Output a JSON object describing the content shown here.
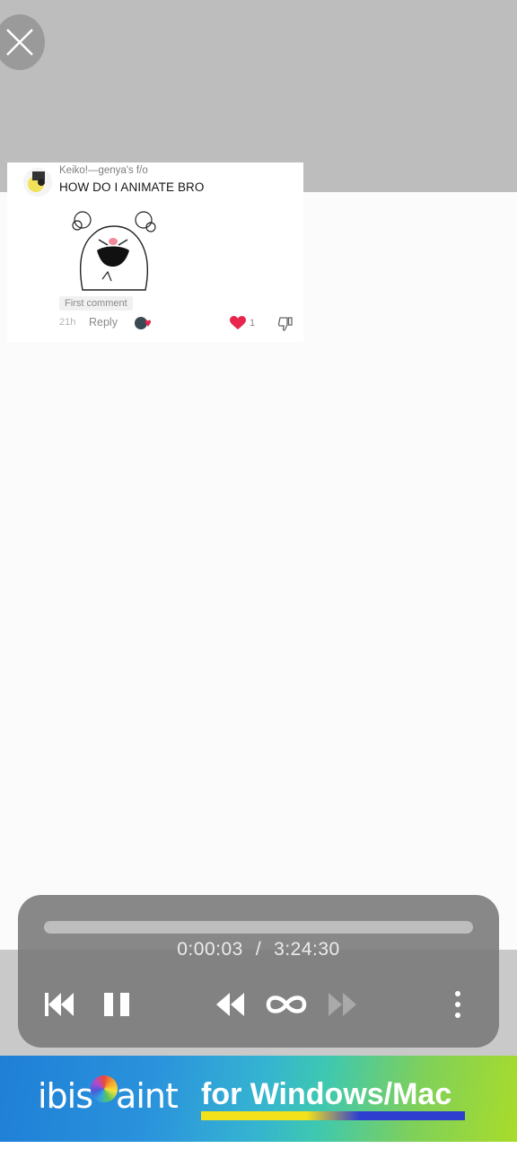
{
  "comment": {
    "username": "Keiko!—genya's f/o",
    "text": "HOW DO I ANIMATE BRO",
    "badge": "First comment",
    "time": "21h",
    "reply_label": "Reply",
    "like_count": "1"
  },
  "player": {
    "current_time": "0:00:03",
    "separator": "/",
    "total_time": "3:24:30",
    "progress": 0.0002
  },
  "ad": {
    "logo_text_left": "ibis",
    "logo_text_right": "aint",
    "tagline": "for Windows/Mac"
  },
  "colors": {
    "like_red": "#e8264d",
    "banner_blue": "#1f7fd6",
    "banner_green": "#a9dc2a"
  }
}
